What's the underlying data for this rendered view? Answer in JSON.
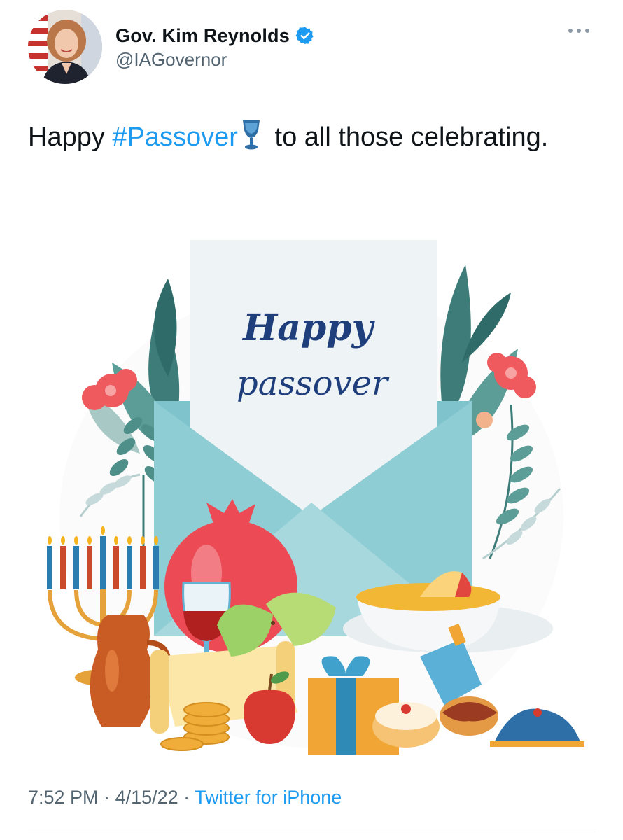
{
  "author": {
    "display_name": "Gov. Kim Reynolds",
    "handle": "@IAGovernor",
    "verified": true
  },
  "tweet": {
    "text_before": "Happy ",
    "hashtag": "#Passover",
    "emoji": "goblet-emoji",
    "text_after": " to all those celebrating."
  },
  "media": {
    "card_title": "Happy",
    "card_subtitle": "passover"
  },
  "meta": {
    "time": "7:52 PM",
    "separator": " · ",
    "date": "4/15/22",
    "source": "Twitter for iPhone"
  },
  "colors": {
    "link": "#1d9bf0",
    "secondary_text": "#536471",
    "primary_text": "#0f1419",
    "verified": "#1d9bf0"
  },
  "icons": [
    "verified-badge-icon",
    "more-options-icon",
    "goblet-emoji"
  ]
}
